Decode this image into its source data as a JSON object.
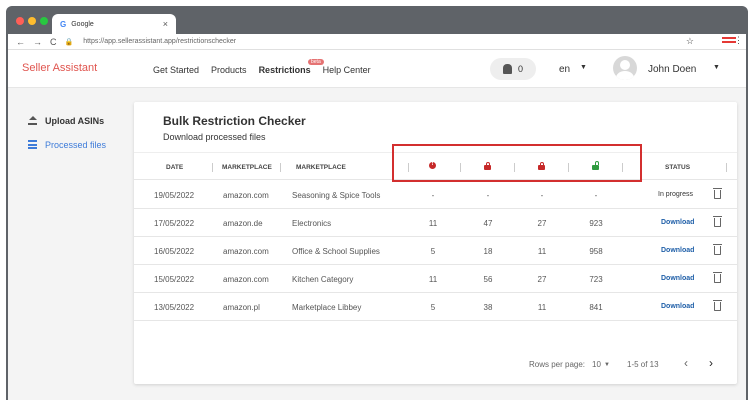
{
  "browser": {
    "tab_title": "Google",
    "tab_close": "×",
    "url": "https://app.sellerassistant.app/restrictionschecker",
    "dot_colors": [
      "#ff5f57",
      "#febc2e",
      "#28c840"
    ]
  },
  "header": {
    "brand": "Seller Assistant",
    "nav": [
      "Get Started",
      "Products",
      "Restrictions",
      "Help Center"
    ],
    "beta": "beta",
    "notifications": "0",
    "language": "en",
    "user_name": "John Doen"
  },
  "sidebar": {
    "items": [
      {
        "label": "Upload ASINs",
        "icon": "upload-icon"
      },
      {
        "label": "Processed files",
        "icon": "list-icon"
      }
    ]
  },
  "card": {
    "title": "Bulk Restriction Checker",
    "subtitle": "Download processed files"
  },
  "table": {
    "headers": [
      "DATE",
      "MARKETPLACE",
      "MARKETPLACE",
      "STATUS"
    ],
    "icons": [
      "alert-icon",
      "lock-red-icon",
      "lock-red-icon",
      "unlock-green-icon"
    ],
    "rows": [
      {
        "date": "19/05/2022",
        "marketplace": "amazon.com",
        "category": "Seasoning & Spice Tools",
        "c1": "-",
        "c2": "-",
        "c3": "-",
        "c4": "-",
        "status": "In progress"
      },
      {
        "date": "17/05/2022",
        "marketplace": "amazon.de",
        "category": "Electronics",
        "c1": "11",
        "c2": "47",
        "c3": "27",
        "c4": "923",
        "status": "Download"
      },
      {
        "date": "16/05/2022",
        "marketplace": "amazon.com",
        "category": "Office & School Supplies",
        "c1": "5",
        "c2": "18",
        "c3": "11",
        "c4": "958",
        "status": "Download"
      },
      {
        "date": "15/05/2022",
        "marketplace": "amazon.com",
        "category": "Kitchen Category",
        "c1": "11",
        "c2": "56",
        "c3": "27",
        "c4": "723",
        "status": "Download"
      },
      {
        "date": "13/05/2022",
        "marketplace": "amazon.pl",
        "category": "Marketplace Libbey",
        "c1": "5",
        "c2": "38",
        "c3": "11",
        "c4": "841",
        "status": "Download"
      }
    ]
  },
  "pagination": {
    "rows_label": "Rows per page:",
    "rows_value": "10",
    "range": "1-5 of 13",
    "prev": "‹",
    "next": "›"
  }
}
